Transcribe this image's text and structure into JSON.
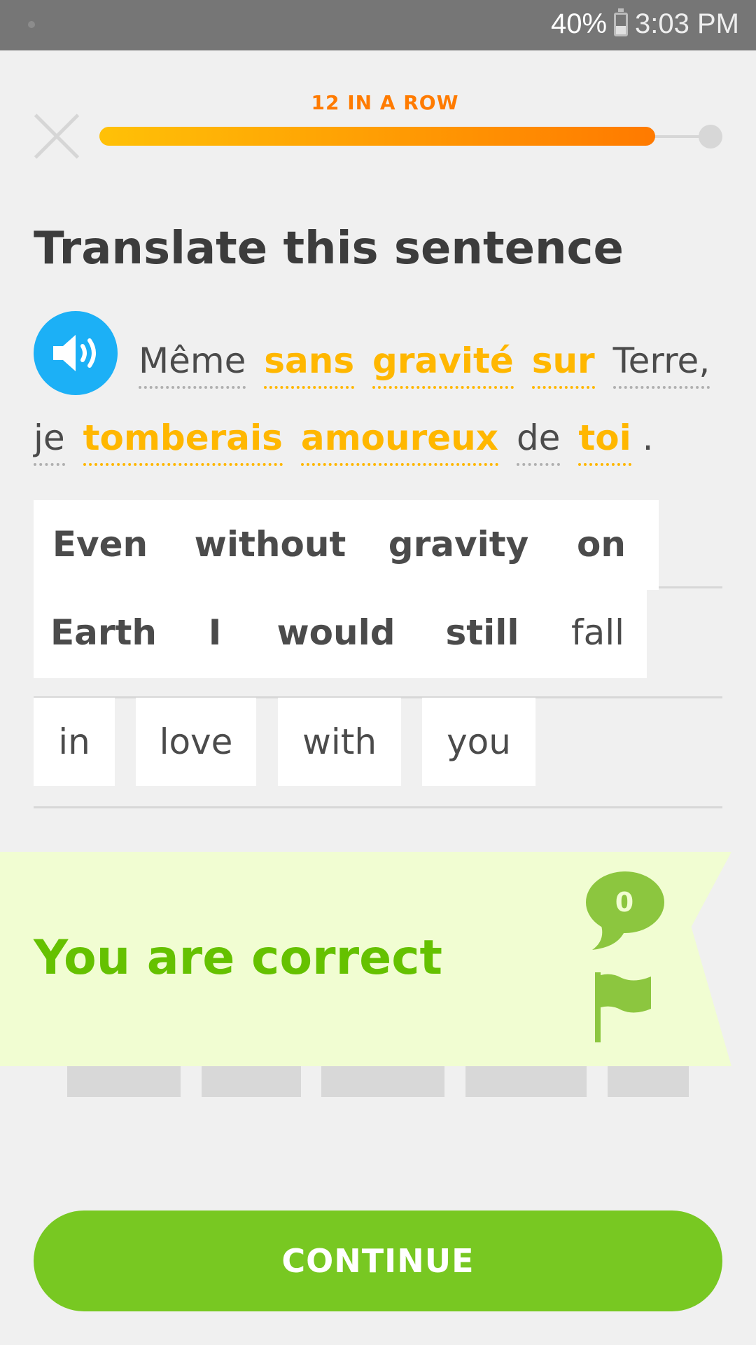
{
  "status_bar": {
    "battery_label": "40%",
    "battery_level": 0.4,
    "time": "3:03 PM"
  },
  "header": {
    "streak_label": "12 IN A ROW",
    "progress": 0.91
  },
  "exercise": {
    "title": "Translate this sentence",
    "sentence_words": [
      {
        "text": "Même",
        "highlight": false
      },
      {
        "text": "sans",
        "highlight": true
      },
      {
        "text": "gravité",
        "highlight": true
      },
      {
        "text": "sur",
        "highlight": true
      },
      {
        "text": "Terre,",
        "highlight": false
      },
      {
        "text": "je",
        "highlight": false
      },
      {
        "text": "tomberais",
        "highlight": true
      },
      {
        "text": "amoureux",
        "highlight": true
      },
      {
        "text": "de",
        "highlight": false
      },
      {
        "text": "toi",
        "highlight": true
      }
    ],
    "sentence_end": "."
  },
  "answer_tiles": [
    "Even",
    "without",
    "gravity",
    "on",
    "Earth",
    "I",
    "would",
    "still",
    "fall",
    "in",
    "love",
    "with",
    "you"
  ],
  "feedback": {
    "message": "You are correct",
    "comment_count": "0"
  },
  "colors": {
    "accent_green": "#78c822",
    "correct_text": "#65c100",
    "highlight": "#ffb700",
    "speaker": "#1cb0f6"
  },
  "continue_label": "CONTINUE"
}
